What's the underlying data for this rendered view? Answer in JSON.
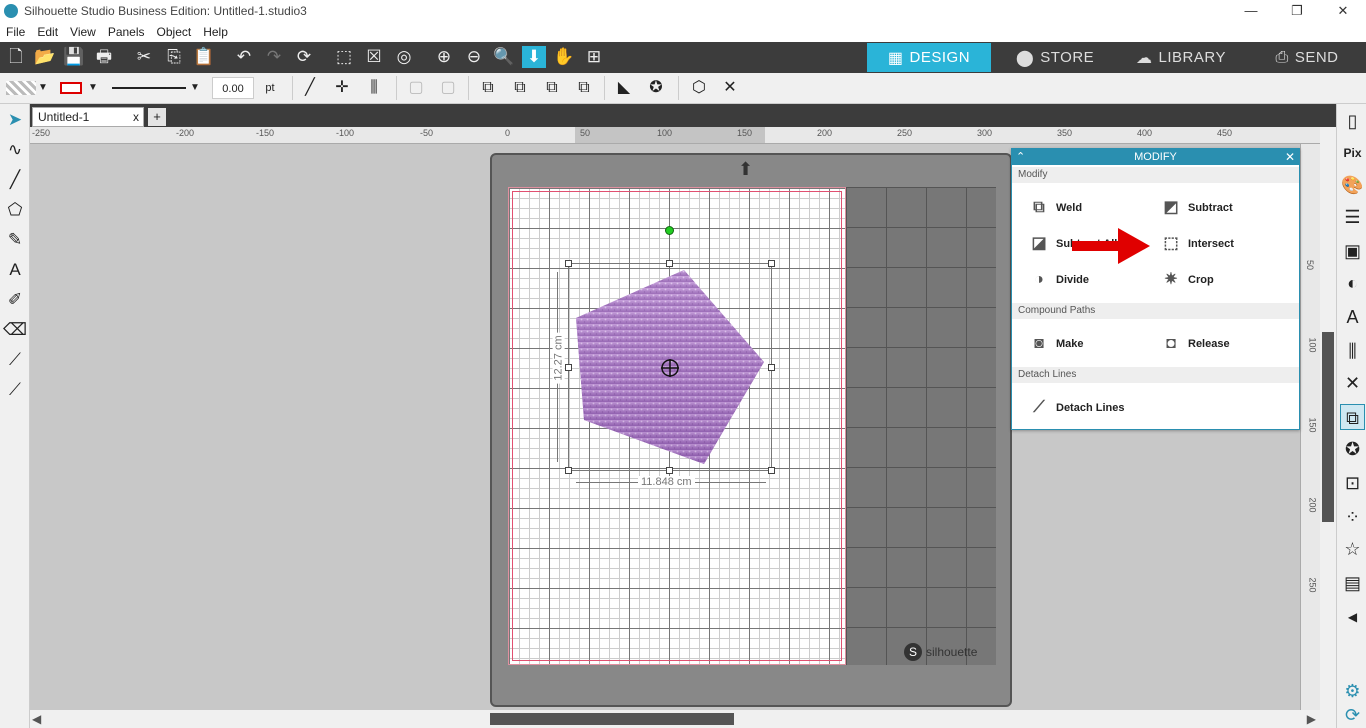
{
  "window": {
    "title": "Silhouette Studio Business Edition: Untitled-1.studio3",
    "minimize": "—",
    "maximize": "❐",
    "close": "✕"
  },
  "menu": [
    "File",
    "Edit",
    "View",
    "Panels",
    "Object",
    "Help"
  ],
  "nav_tabs": [
    {
      "label": "DESIGN",
      "icon": "design-grid-icon",
      "active": true
    },
    {
      "label": "STORE",
      "icon": "store-icon",
      "active": false
    },
    {
      "label": "LIBRARY",
      "icon": "cloud-library-icon",
      "active": false
    },
    {
      "label": "SEND",
      "icon": "cutter-send-icon",
      "active": false
    }
  ],
  "toolbar2": {
    "line_weight_value": "0.00",
    "line_weight_unit": "pt"
  },
  "document_tab": {
    "label": "Untitled-1",
    "close": "x",
    "add": "+"
  },
  "ruler": {
    "h_ticks": [
      "-250",
      "-200",
      "-150",
      "-100",
      "-50",
      "0",
      "50",
      "100",
      "150",
      "200",
      "250",
      "300",
      "350",
      "400",
      "450"
    ],
    "v_ticks": [
      "50",
      "100",
      "150",
      "200",
      "250"
    ]
  },
  "selection": {
    "width_label": "11.848 cm",
    "height_label": "12.27 cm"
  },
  "mat": {
    "brand": "silhouette"
  },
  "modify_panel": {
    "title": "MODIFY",
    "sections": {
      "modify": "Modify",
      "compound_paths": "Compound Paths",
      "detach_lines": "Detach Lines"
    },
    "ops": {
      "weld": "Weld",
      "subtract": "Subtract",
      "subtract_all": "Subtract All",
      "intersect": "Intersect",
      "divide": "Divide",
      "crop": "Crop",
      "make": "Make",
      "release": "Release",
      "detach_lines": "Detach Lines"
    }
  },
  "colors": {
    "accent": "#2ab4d8",
    "toolbar_dark": "#3c3c3c",
    "arrow": "#e00000",
    "glitter": "#b58ad0"
  }
}
